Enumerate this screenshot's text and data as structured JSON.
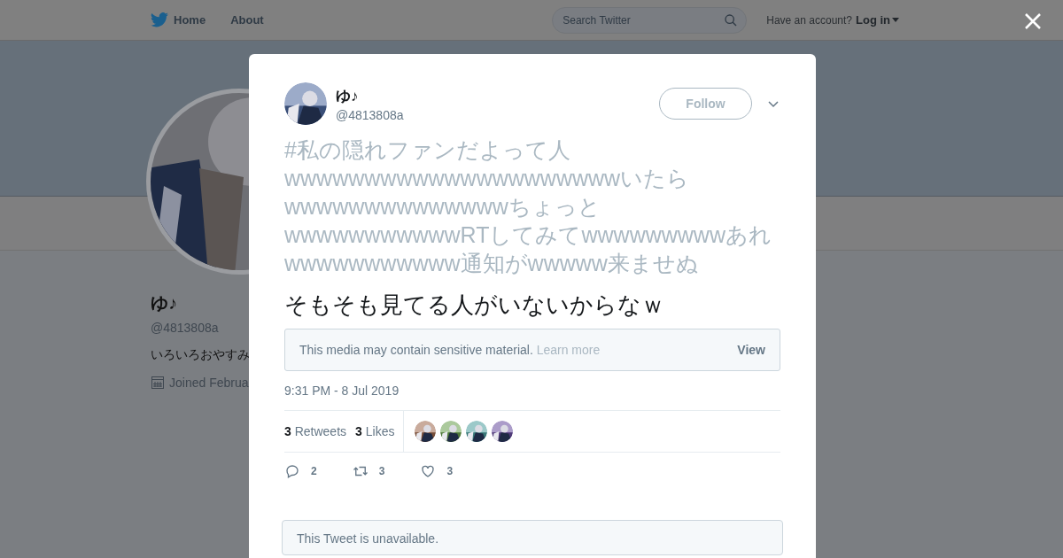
{
  "nav": {
    "items": [
      {
        "label": "Home",
        "kind": "logo"
      },
      {
        "label": "About",
        "kind": "plain"
      }
    ],
    "search": {
      "placeholder": "Search Twitter"
    },
    "account_prompt": "Have an account?",
    "login": "Log in"
  },
  "profile": {
    "name": "ゆ♪",
    "handle": "@4813808a",
    "bio": "いろいろおやすみ",
    "joined": "Joined Februa"
  },
  "tweet": {
    "name": "ゆ♪",
    "handle": "@4813808a",
    "follow": "Follow",
    "quoted_text": "#私の隠れファンだよって人wwwwwwwwwwwwwwwwwwwwwいたらwwwwwwwwwwwwwwちょっとwwwwwwwwwwwRTしてみてwwwwwwwwwあれwwwwwwwwwww通知がwwwww来ませぬ",
    "text": "そもそも見てる人がいないからなｗ",
    "sensitive": {
      "message": "This media may contain sensitive material.",
      "link": "Learn more",
      "action": "View"
    },
    "time": "9:31 PM - 8 Jul 2019",
    "stats": [
      {
        "count": "3",
        "label": "Retweets"
      },
      {
        "count": "3",
        "label": "Likes"
      }
    ],
    "actions": [
      {
        "kind": "reply",
        "count": "2"
      },
      {
        "kind": "retweet",
        "count": "3"
      },
      {
        "kind": "like",
        "count": "3"
      }
    ],
    "unavailable": "This Tweet is unavailable."
  }
}
